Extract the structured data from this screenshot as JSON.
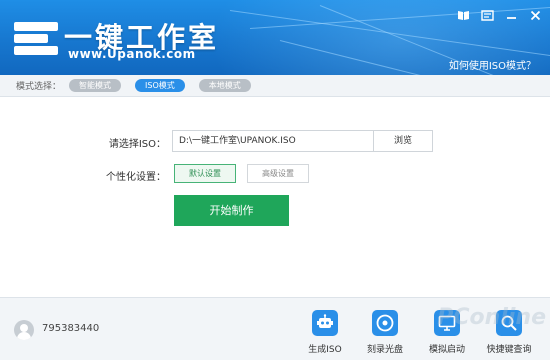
{
  "app": {
    "logo_text": "一键工作室",
    "logo_url": "www.Upanok.com",
    "help_link": "如何使用ISO模式？"
  },
  "mode_bar": {
    "label": "模式选择：",
    "modes": [
      {
        "label": "智能模式",
        "active": false
      },
      {
        "label": "ISO模式",
        "active": true
      },
      {
        "label": "本地模式",
        "active": false
      }
    ]
  },
  "form": {
    "iso_label": "请选择ISO：",
    "iso_path": "D:\\一键工作室\\UPANOK.ISO",
    "browse_label": "浏览",
    "personalize_label": "个性化设置：",
    "default_setting": "默认设置",
    "advanced_setting": "高级设置",
    "start_label": "开始制作"
  },
  "footer": {
    "qq_number": "795383440",
    "tools": [
      {
        "label": "生成ISO",
        "icon": "robot-icon"
      },
      {
        "label": "刻录光盘",
        "icon": "disc-icon"
      },
      {
        "label": "模拟启动",
        "icon": "monitor-icon"
      },
      {
        "label": "快捷键查询",
        "icon": "magnifier-icon"
      }
    ]
  },
  "watermark": "PConline",
  "colors": {
    "header": "#1777cf",
    "active_mode": "#2a8fe8",
    "start_button": "#1fa65a",
    "tool_icon": "#2a8fe8"
  }
}
